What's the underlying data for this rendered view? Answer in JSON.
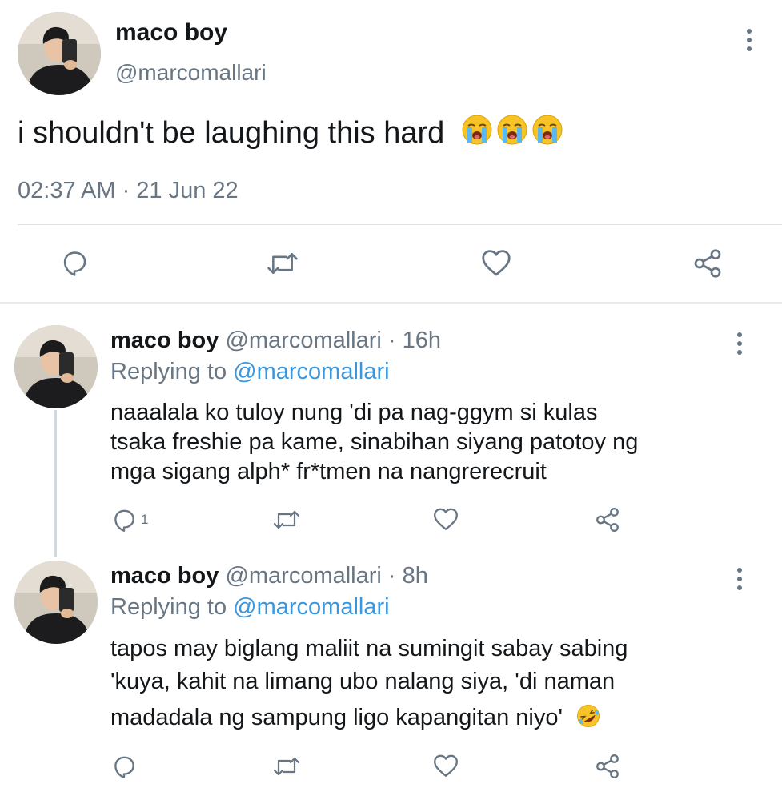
{
  "main_tweet": {
    "display_name": "maco boy",
    "handle": "@marcomallari",
    "text": "i shouldn't be laughing this hard",
    "emojis": [
      "loudly-crying-face",
      "loudly-crying-face",
      "loudly-crying-face"
    ],
    "timestamp": "02:37 AM · 21 Jun 22",
    "icons": [
      "reply-icon",
      "retweet-icon",
      "like-icon",
      "share-icon"
    ]
  },
  "replies": [
    {
      "display_name": "maco boy",
      "handle": "@marcomallari · 16h",
      "replying_prefix": "Replying to ",
      "replying_to": "@marcomallari",
      "lines": [
        "naaalala ko tuloy nung 'di pa nag-ggym si kulas",
        "tsaka freshie pa kame, sinabihan siyang patotoy ng",
        "mga sigang alph* fr*tmen na nangrerecruit"
      ],
      "reply_count": "1"
    },
    {
      "display_name": "maco boy",
      "handle": "@marcomallari · 8h",
      "replying_prefix": "Replying to ",
      "replying_to": "@marcomallari",
      "lines": [
        "tapos may biglang maliit na sumingit sabay sabing",
        "'kuya, kahit na limang ubo nalang siya, 'di naman",
        "madadala ng sampung ligo kapangitan niyo'"
      ],
      "trailing_emoji": "rolling-on-the-floor-laughing",
      "reply_count": ""
    }
  ],
  "colors": {
    "text": "#14171a",
    "secondary": "#687684",
    "mention": "#3a96dd",
    "divider": "#dfe3e6"
  }
}
